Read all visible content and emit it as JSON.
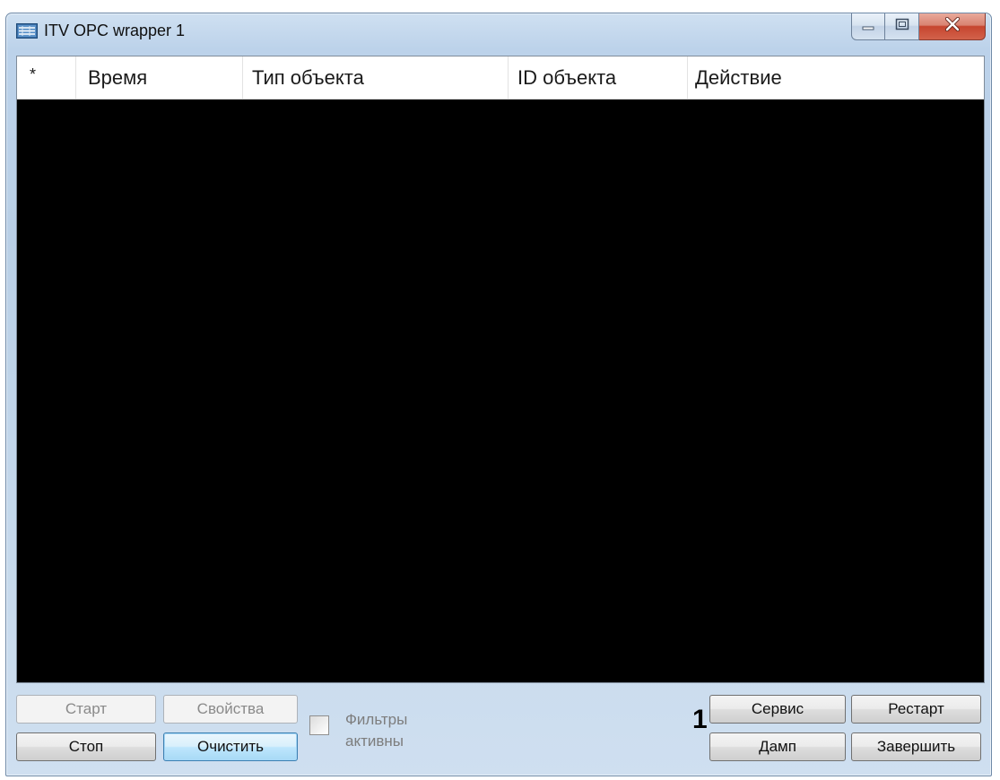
{
  "window": {
    "title": "ITV OPC wrapper 1",
    "icons": {
      "app": "network-app-icon",
      "minimize": "minimize-icon",
      "maximize": "maximize-icon",
      "close": "close-icon"
    }
  },
  "table": {
    "columns": [
      "*",
      "Время",
      "Тип объекта",
      "ID объекта",
      "Действие"
    ],
    "rows": []
  },
  "buttons": {
    "start": "Старт",
    "properties": "Свойства",
    "stop": "Стоп",
    "clear": "Очистить",
    "service": "Сервис",
    "restart": "Рестарт",
    "dump": "Дамп",
    "finish": "Завершить"
  },
  "filters": {
    "label_line1": "Фильтры",
    "label_line2": "активны",
    "checked": false
  },
  "annotation": "1",
  "colors": {
    "log_background": "#000000",
    "window_frame": "#bcd2ea",
    "close_button": "#c6452f"
  }
}
